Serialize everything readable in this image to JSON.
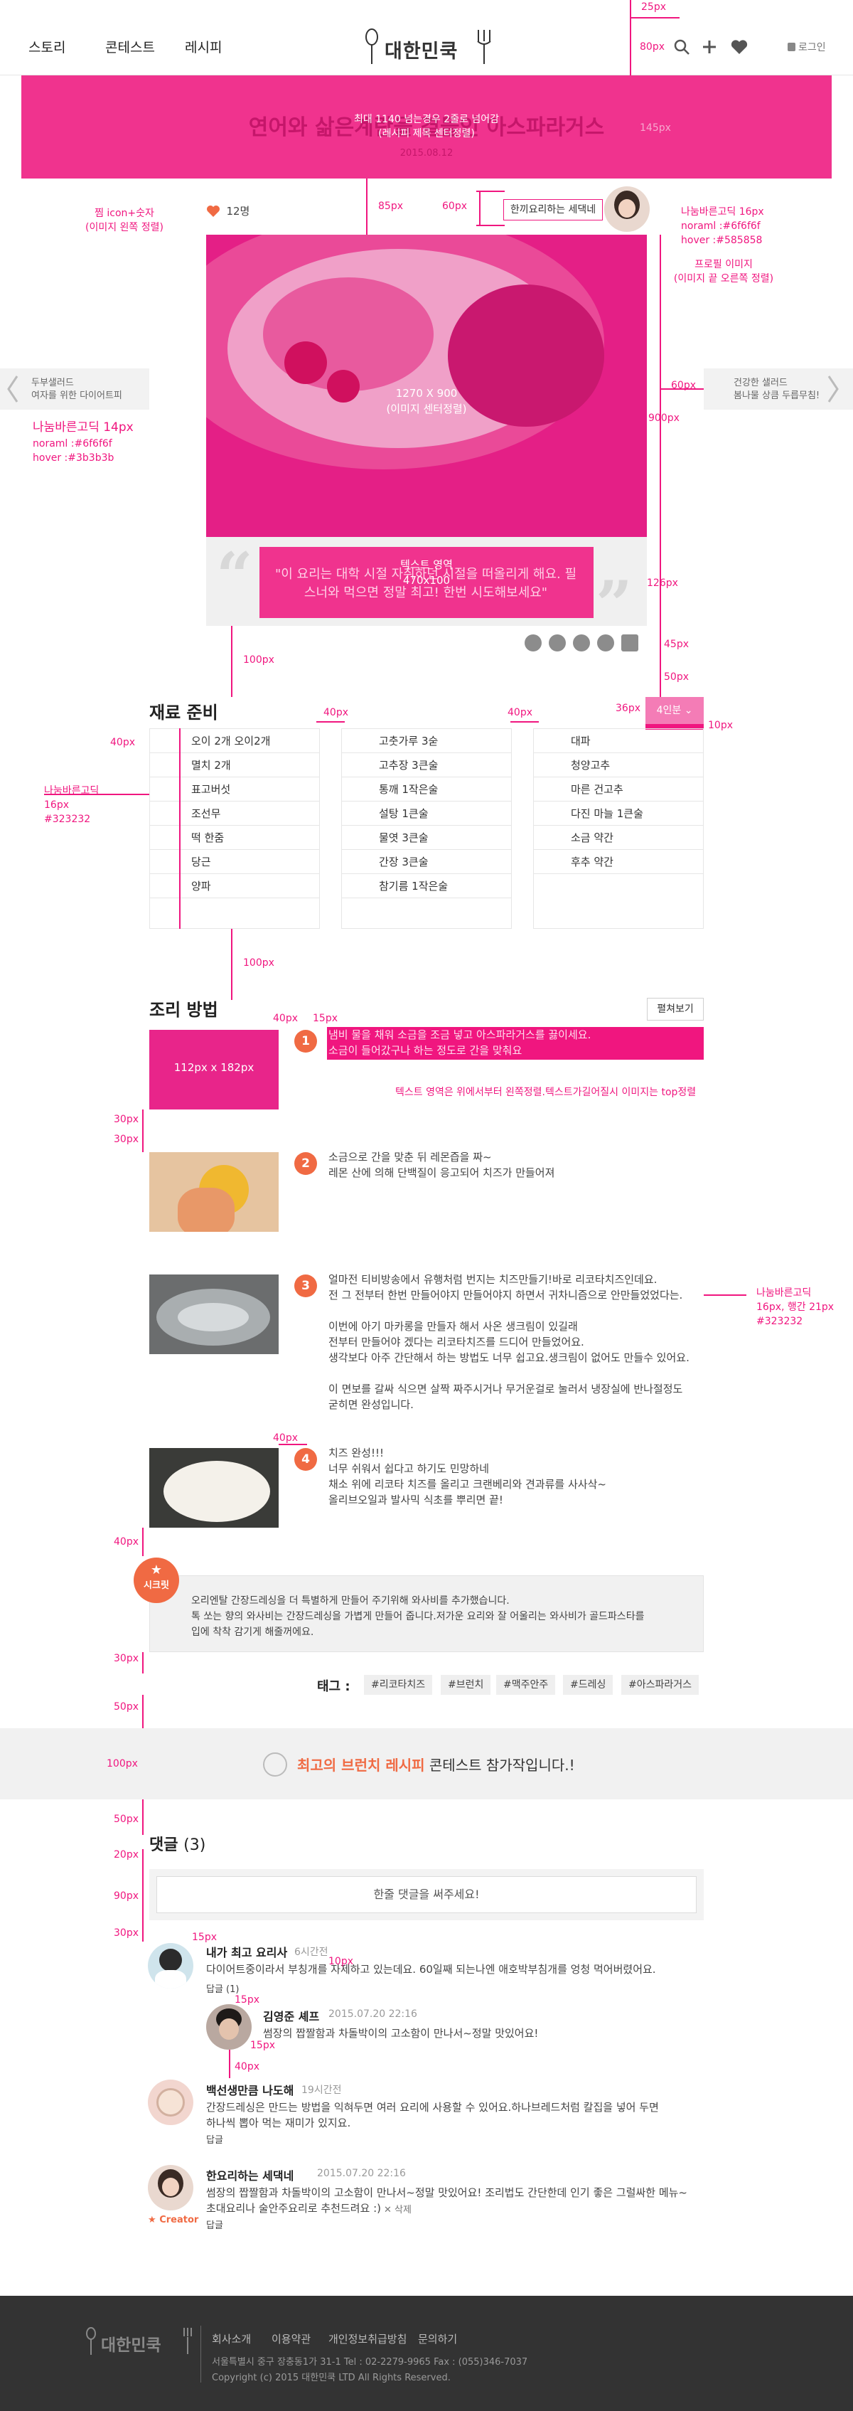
{
  "header": {
    "nav": [
      "스토리",
      "콘테스트",
      "레시피"
    ],
    "logo": "대한민쿡",
    "login": "로그인"
  },
  "hero": {
    "title": "연어와 삶은계란을 곁들인 아스파라거스",
    "note1": "최대 1140 넘는경우 2줄로 넘어감",
    "note2": "(레시피 제목 센터정렬)",
    "date": "2015.08.12"
  },
  "meta": {
    "likes": "12명",
    "author_tag": "한끼요리하는 세댁네"
  },
  "main_image": {
    "size_label": "1270 X 900",
    "caption": "(이미지 센터정렬)"
  },
  "quote": {
    "text": "\"이 요리는 대학 시절 자취하던 시절을 떠올리게 해요. 필스너와 먹으면 정말 최고! 한번 시도해보세요\"",
    "label": "텍스트 영역",
    "size": "470x100"
  },
  "side": {
    "prev_line1": "두부샐러드",
    "prev_line2": "여자를 위한 다이어트피",
    "next_line1": "건강한 샐러드",
    "next_line2": "봄나물 상큼 두릅무침!"
  },
  "specs": {
    "s25": "25px",
    "s80": "80px",
    "s145": "145px",
    "s85": "85px",
    "s60": "60px",
    "like_note1": "찜 icon+숫자",
    "like_note2": "(이미지 왼쪽 정렬)",
    "font1": "나눔바른고딕 16px",
    "font1b": "noraml :#6f6f6f",
    "font1c": "hover :#585858",
    "profile1": "프로필 이미지",
    "profile2": "(이미지 끝 오른쪽 정렬)",
    "s900": "900px",
    "s60b": "60px",
    "font2": "나눔바른고딕 14px",
    "font2b": "noraml :#6f6f6f",
    "font2c": "hover :#3b3b3b",
    "s126": "126px",
    "s45": "45px",
    "s50": "50px",
    "s36": "36px",
    "s10": "10px",
    "s100": "100px",
    "s40": "40px",
    "s40b": "40px",
    "s40c": "40px",
    "font3": "나눔바른고딕",
    "font3b": "16px",
    "font3c": "#323232",
    "s100b": "100px",
    "s40d": "40px",
    "s15": "15px",
    "img_size": "112px x 182px",
    "text_note": "텍스트 영역은 위에서부터 왼쪽정렬.텍스트가길어질시 이미지는 top정렬",
    "s30": "30px",
    "s30b": "30px",
    "font4": "나눔바른고딕",
    "font4b": "16px, 행간 21px",
    "font4c": "#323232",
    "s40e": "40px",
    "s40f": "40px",
    "s30c": "30px",
    "s50b": "50px",
    "s100c": "100px",
    "s50c": "50px",
    "s20": "20px",
    "s90": "90px",
    "s30d": "30px",
    "c15": "15px",
    "c10": "10px",
    "c15b": "15px",
    "c15c": "15px",
    "c40": "40px"
  },
  "ingredients": {
    "title": "재료 준비",
    "portion": "4인분",
    "col1": [
      "오이 2개    오이2개",
      "멸치 2개",
      "표고버섯",
      "조선무",
      "떡 한줌",
      "당근",
      "양파"
    ],
    "col2": [
      "고춧가루 3숟",
      "고추장 3큰술",
      "통깨 1작은술",
      "설탕 1큰술",
      "물엿 3큰술",
      "간장 3큰술",
      "참기름 1작은술"
    ],
    "col3": [
      "대파",
      "청양고추",
      "마른 건고추",
      "다진 마늘 1큰술",
      "소금 약간",
      "후추 약간"
    ]
  },
  "steps": {
    "title": "조리 방법",
    "fold": "펼쳐보기",
    "items": [
      {
        "num": "1",
        "text": "냄비 물을 채워 소금을 조금 넣고 아스파라거스를 끓이세요.\n소금이 들어갔구나 하는 정도로 간을 맞춰요"
      },
      {
        "num": "2",
        "text": "소금으로 간을 맞춘 뒤 레몬즙을 짜~\n레몬 산에 의해 단백질이 응고되어 치즈가 만들어져"
      },
      {
        "num": "3",
        "text": "얼마전 티비방송에서 유행처럼 번지는 치즈만들기!바로 리코타치즈인데요.\n전 그 전부터 한번 만들어야지 만들어야지 하면서 귀차니즘으로 안만들었었다는.\n\n이번에 아기 마카롱을 만들자 해서 사온 생크림이 있길래\n전부터 만들어야 겠다는 리코타치즈를 드디어 만들었어요.\n생각보다 아주 간단해서 하는 방법도 너무 쉽고요.생크림이 없어도 만들수 있어요.\n\n이 면보를 갈싸 식으면 살짝 짜주시거나 무거운걸로 눌러서 냉장실에 반나절정도\n굳히면 완성입니다."
      },
      {
        "num": "4",
        "text": "치즈 완성!!!\n너무 쉬워서 쉽다고 하기도 민망하네\n채소 위에 리코타 치즈를 올리고 크랜베리와 견과류를 사사삭~\n올리브오일과 발사믹 식초를 뿌리면 끝!"
      }
    ]
  },
  "tip": {
    "badge": "시크릿",
    "text": "오리엔탈 간장드레싱을 더 특별하게 만들어 주기위해 와사비를 추가했습니다.\n톡 쏘는 향의 와사비는 간장드레싱을 가볍게 만들어 줍니다.저가운 요리와 잘 어울리는 와사비가 골드파스타를\n입에 착착 감기게 해줄꺼에요."
  },
  "tags": {
    "label": "태그 :",
    "items": [
      "#리코타치즈",
      "#브런치",
      "#맥주안주",
      "#드레싱",
      "#아스파라거스"
    ]
  },
  "contest": {
    "highlight": "최고의 브런치 레시피",
    "rest": " 콘테스트 참가작입니다.!"
  },
  "comments": {
    "title": "댓글",
    "count": "(3)",
    "placeholder": "한줄 댓글을 써주세요!",
    "items": [
      {
        "name": "내가 최고 요리사",
        "time": "6시간전",
        "body": "다이어트중이라서 부칭개를 자제하고 있는데요. 60일째 되는나엔 애호박부침개를 엉청 먹어버렸어요.",
        "reply": "답글 (1)"
      },
      {
        "name": "김영준 셰프",
        "time": "2015.07.20  22:16",
        "body": "썸장의 짭짤함과 차돌박이의 고소함이 만나서~정말 맛있어요!",
        "reply": ""
      },
      {
        "name": "백선생만큼 나도해",
        "time": "19시간전",
        "body": "간장드레싱은 만드는 방법을 익혀두면 여러 요리에 사용할 수 있어요.하나브레드처럼 칼집을 넣어 두면\n하나씩 뽑아 먹는 재미가 있지요.",
        "reply": "답글"
      },
      {
        "name": "한요리하는 세댁네",
        "time": "2015.07.20  22:16",
        "body": "썸장의 짭짤함과 차돌박이의 고소함이 만나서~정말 맛있어요! 조리법도 간단한데 인기 좋은 그럴싸한 메뉴~\n초대요리나 술안주요리로 추천드려요 :)",
        "reply": "답글",
        "badge": "Creator",
        "delete": "삭제"
      }
    ]
  },
  "footer": {
    "logo": "대한민쿡",
    "links": [
      "회사소개",
      "이용약관",
      "개인정보취급방침",
      "문의하기"
    ],
    "address": "서울특별시 중구 장충동1가 31-1  Tel : 02-2279-9965   Fax : (055)346-7037",
    "copyright": "Copyright (c) 2015 대한민쿡 LTD All Rights Reserved."
  },
  "colors": {
    "accent": "#f0167f",
    "step_num": "#f06a43",
    "footer": "#333333"
  }
}
